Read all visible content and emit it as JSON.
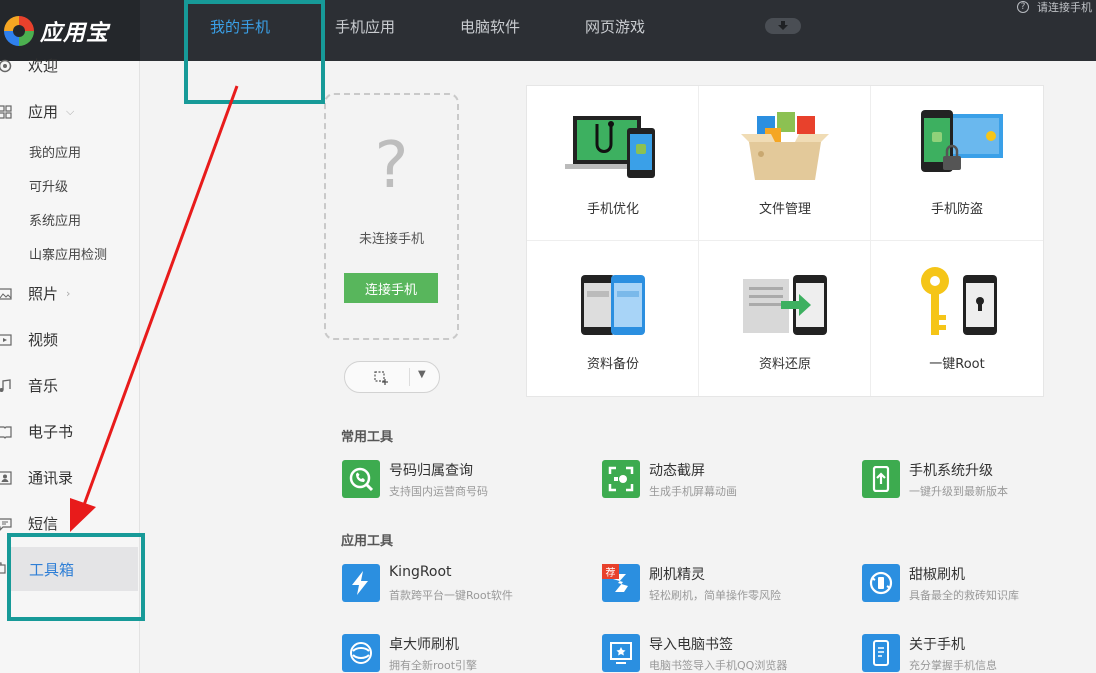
{
  "app": {
    "title": "应用宝"
  },
  "top_nav": {
    "tabs": [
      {
        "label": "我的手机"
      },
      {
        "label": "手机应用"
      },
      {
        "label": "电脑软件"
      },
      {
        "label": "网页游戏"
      }
    ],
    "connect_hint": "请连接手机"
  },
  "sidebar": {
    "items": [
      {
        "label": "欢迎",
        "icon": "welcome-icon"
      },
      {
        "label": "应用",
        "icon": "grid-icon"
      },
      {
        "label": "照片",
        "icon": "image-icon"
      },
      {
        "label": "视频",
        "icon": "video-icon"
      },
      {
        "label": "音乐",
        "icon": "music-icon"
      },
      {
        "label": "电子书",
        "icon": "book-icon"
      },
      {
        "label": "通讯录",
        "icon": "contacts-icon"
      },
      {
        "label": "短信",
        "icon": "message-icon"
      },
      {
        "label": "工具箱",
        "icon": "toolbox-icon"
      }
    ],
    "app_sub": [
      "我的应用",
      "可升级",
      "系统应用",
      "山寨应用检测"
    ]
  },
  "phone": {
    "placeholder_glyph": "?",
    "not_connected": "未连接手机",
    "connect_button": "连接手机"
  },
  "features": [
    {
      "label": "手机优化"
    },
    {
      "label": "文件管理"
    },
    {
      "label": "手机防盗"
    },
    {
      "label": "资料备份"
    },
    {
      "label": "资料还原"
    },
    {
      "label": "一键Root"
    }
  ],
  "sections": {
    "common": "常用工具",
    "apps": "应用工具"
  },
  "common_tools": [
    {
      "name": "号码归属查询",
      "desc": "支持国内运营商号码"
    },
    {
      "name": "动态截屏",
      "desc": "生成手机屏幕动画"
    },
    {
      "name": "手机系统升级",
      "desc": "一键升级到最新版本"
    }
  ],
  "app_tools": [
    {
      "name": "KingRoot",
      "desc": "首款跨平台一键Root软件"
    },
    {
      "name": "刷机精灵",
      "desc": "轻松刷机，简单操作零风险",
      "badge": "荐"
    },
    {
      "name": "甜椒刷机",
      "desc": "具备最全的救砖知识库"
    },
    {
      "name": "卓大师刷机",
      "desc": "拥有全新root引擎"
    },
    {
      "name": "导入电脑书签",
      "desc": "电脑书签导入手机QQ浏览器"
    },
    {
      "name": "关于手机",
      "desc": "充分掌握手机信息"
    }
  ],
  "colors": {
    "accent_blue": "#3aa0e8",
    "highlight_teal": "#179a98",
    "connect_green": "#58b65c",
    "tool_green": "#3dab4f",
    "tool_blue": "#2b8fe0",
    "arrow_red": "#e81b1b"
  }
}
